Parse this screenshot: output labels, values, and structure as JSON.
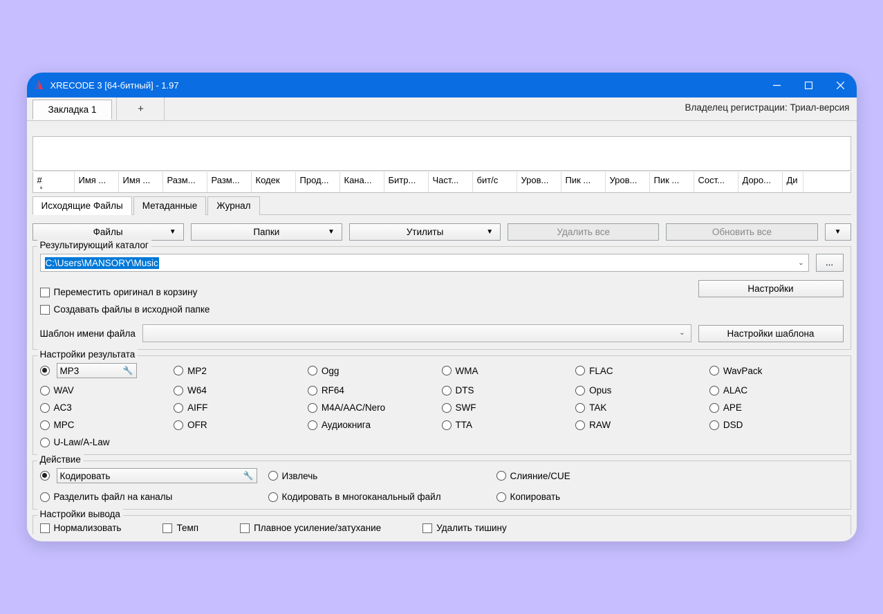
{
  "title": "XRECODE 3 [64-битный] - 1.97",
  "tab1": "Закладка 1",
  "tab_plus": "+",
  "registration": "Владелец регистрации: Триал-версия",
  "columns": [
    "#",
    "Имя ...",
    "Имя ...",
    "Разм...",
    "Разм...",
    "Кодек",
    "Прод...",
    "Кана...",
    "Битр...",
    "Част...",
    "бит/с",
    "Уров...",
    "Пик ...",
    "Уров...",
    "Пик ...",
    "Сост...",
    "Доро...",
    "Ди"
  ],
  "subtabs": {
    "outgoing": "Исходящие Файлы",
    "metadata": "Метаданные",
    "log": "Журнал"
  },
  "btns": {
    "files": "Файлы",
    "folders": "Папки",
    "utils": "Утилиты",
    "delall": "Удалить все",
    "refreshall": "Обновить все"
  },
  "rescatalog": {
    "legend": "Результирующий каталог",
    "path": "C:\\Users\\MANSORY\\Music",
    "browse": "...",
    "moveorig": "Переместить оригинал в корзину",
    "createsrc": "Создавать файлы в исходной папке",
    "settings": "Настройки",
    "tmpllabel": "Шаблон имени файла",
    "tmplsettings": "Настройки шаблона"
  },
  "results": {
    "legend": "Настройки результата",
    "formats": [
      "MP3",
      "MP2",
      "Ogg",
      "WMA",
      "FLAC",
      "WavPack",
      "WAV",
      "W64",
      "RF64",
      "DTS",
      "Opus",
      "ALAC",
      "AC3",
      "AIFF",
      "M4A/AAC/Nero",
      "SWF",
      "TAK",
      "APE",
      "MPC",
      "OFR",
      "Аудиокнига",
      "TTA",
      "RAW",
      "DSD",
      "U-Law/A-Law"
    ]
  },
  "action": {
    "legend": "Действие",
    "encode": "Кодировать",
    "extract": "Извлечь",
    "merge": "Слияние/CUE",
    "split": "Разделить файл на каналы",
    "multichan": "Кодировать в многоканальный файл",
    "copy": "Копировать"
  },
  "output": {
    "legend": "Настройки вывода",
    "normalize": "Нормализовать",
    "tempo": "Темп",
    "fade": "Плавное усиление/затухание",
    "silence": "Удалить тишину"
  }
}
